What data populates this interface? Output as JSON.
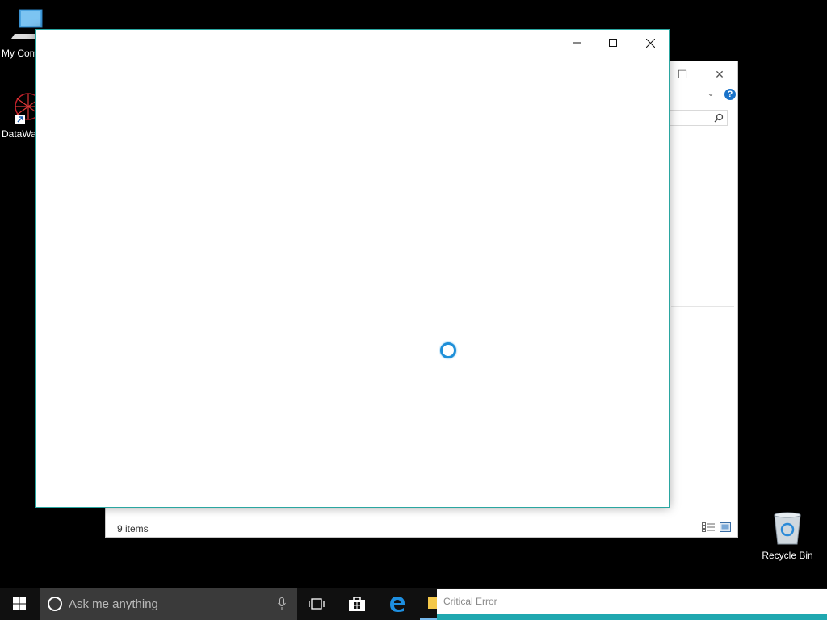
{
  "desktop": {
    "icons": [
      {
        "label": "My Computer"
      },
      {
        "label": "DataWarehouse"
      },
      {
        "label": "Recycle Bin"
      }
    ]
  },
  "explorer": {
    "status_text": "9 items",
    "help_label": "?"
  },
  "taskbar": {
    "search_placeholder": "Ask me anything",
    "notification_title": "Critical Error"
  },
  "colors": {
    "accent": "#2aa6a1",
    "taskbar": "#101010",
    "spinner": "#1e8fd8"
  }
}
